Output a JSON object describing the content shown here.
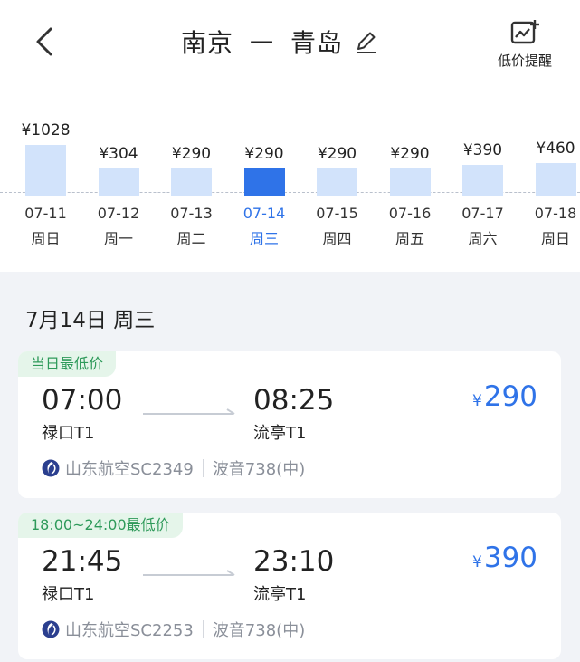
{
  "header": {
    "origin": "南京",
    "separator": "一",
    "destination": "青岛",
    "alert_label": "低价提醒"
  },
  "calendar": [
    {
      "price": "¥1028",
      "value": 1028,
      "date": "07-11",
      "weekday": "周日",
      "selected": false
    },
    {
      "price": "¥304",
      "value": 304,
      "date": "07-12",
      "weekday": "周一",
      "selected": false
    },
    {
      "price": "¥290",
      "value": 290,
      "date": "07-13",
      "weekday": "周二",
      "selected": false
    },
    {
      "price": "¥290",
      "value": 290,
      "date": "07-14",
      "weekday": "周三",
      "selected": true
    },
    {
      "price": "¥290",
      "value": 290,
      "date": "07-15",
      "weekday": "周四",
      "selected": false
    },
    {
      "price": "¥290",
      "value": 290,
      "date": "07-16",
      "weekday": "周五",
      "selected": false
    },
    {
      "price": "¥390",
      "value": 390,
      "date": "07-17",
      "weekday": "周六",
      "selected": false
    },
    {
      "price": "¥460",
      "value": 460,
      "date": "07-18",
      "weekday": "周日",
      "selected": false
    }
  ],
  "day_title": "7月14日 周三",
  "flights": [
    {
      "tag": "当日最低价",
      "dep_time": "07:00",
      "arr_time": "08:25",
      "dep_airport": "禄口T1",
      "arr_airport": "流亭T1",
      "currency": "¥",
      "price": "290",
      "airline": "山东航空SC2349",
      "aircraft": "波音738(中)"
    },
    {
      "tag": "18:00~24:00最低价",
      "dep_time": "21:45",
      "arr_time": "23:10",
      "dep_airport": "禄口T1",
      "arr_airport": "流亭T1",
      "currency": "¥",
      "price": "390",
      "airline": "山东航空SC2253",
      "aircraft": "波音738(中)"
    }
  ],
  "colors": {
    "accent": "#2f73e8",
    "bar": "#d2e3fb",
    "tag_text": "#2e9a5a",
    "tag_bg": "#e5f5ea"
  }
}
